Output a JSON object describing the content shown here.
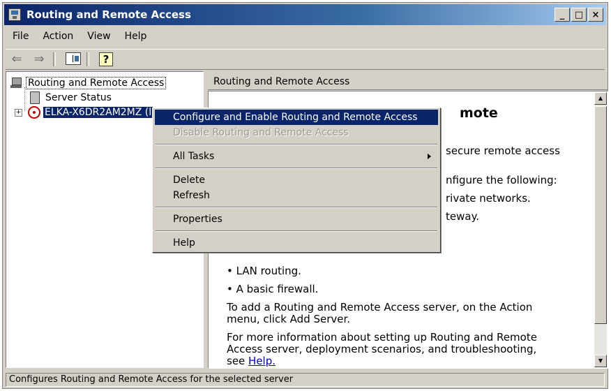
{
  "window": {
    "title": "Routing and Remote Access",
    "controls": [
      "_",
      "□",
      "×"
    ]
  },
  "menu": [
    "File",
    "Action",
    "View",
    "Help"
  ],
  "toolbar": {
    "back_icon": "back-arrow-icon",
    "forward_icon": "forward-arrow-icon",
    "tree_icon": "show-hide-tree-icon",
    "help_icon": "help-icon",
    "help_glyph": "?"
  },
  "tree": {
    "root": "Routing and Remote Access",
    "server_status": "Server Status",
    "server": "ELKA-X6DR2AM2MZ (l",
    "expander": "+"
  },
  "right": {
    "header": "Routing and Remote Access",
    "heading_fragment": "mote",
    "lines": [
      "secure remote access",
      "nfigure the following:",
      "rivate networks.",
      "teway.",
      "• LAN routing.",
      "• A basic firewall.",
      "To add a Routing and Remote Access server, on the Action",
      "menu, click Add Server.",
      "For more information about setting up Routing and Remote",
      "Access server, deployment scenarios, and troubleshooting,"
    ],
    "see_text": "see ",
    "help_link": "Help."
  },
  "context_menu": {
    "items": [
      {
        "label": "Configure and Enable Routing and Remote Access",
        "state": "highlight"
      },
      {
        "label": "Disable Routing and Remote Access",
        "state": "disabled"
      },
      {
        "label": "All Tasks",
        "state": "submenu"
      },
      {
        "label": "Delete",
        "state": "normal"
      },
      {
        "label": "Refresh",
        "state": "normal"
      },
      {
        "label": "Properties",
        "state": "normal"
      },
      {
        "label": "Help",
        "state": "normal"
      }
    ]
  },
  "scrollbar": {
    "up": "▲",
    "down": "▼"
  },
  "status": "Configures Routing and Remote Access for the selected server"
}
